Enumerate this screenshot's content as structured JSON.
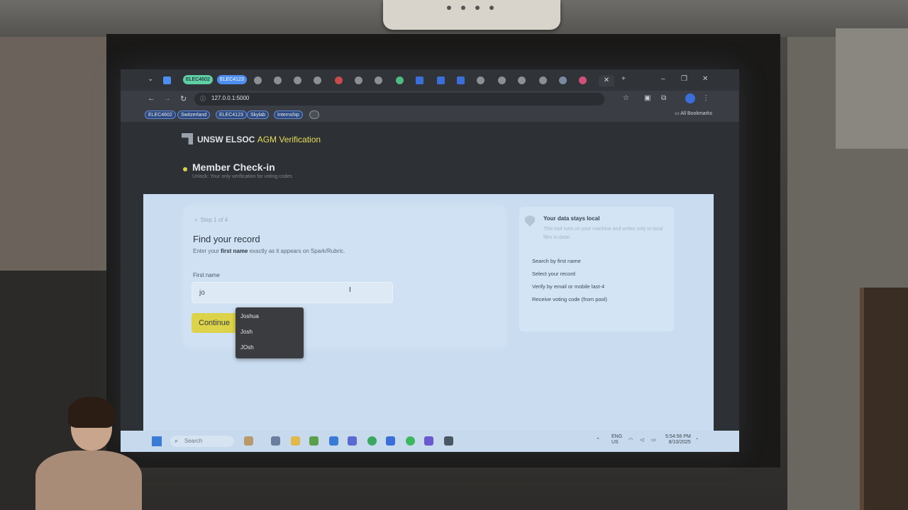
{
  "browser": {
    "tab_pills": [
      "ELEC4602",
      "ELEC4123"
    ],
    "url": "127.0.0.1:5000",
    "bookmarks": [
      "ELEC4602",
      "Switzerland",
      "ELEC4123",
      "Skylab",
      "Internship"
    ],
    "all_bookmarks": "All Bookmarks"
  },
  "app": {
    "brand": "UNSW ELSOC",
    "brand_accent": "AGM Verification",
    "page_title": "Member Check-in",
    "page_subtitle": "Unlock: Your only verification for voting codes"
  },
  "form": {
    "step": "Step 1 of 4",
    "heading": "Find your record",
    "hint_prefix": "Enter your ",
    "hint_bold": "first name",
    "hint_suffix": " exactly as it appears on Spark/Rubric.",
    "field_label": "First name",
    "input_value": "jo",
    "continue_label": "Continue",
    "suggestions": [
      "Joshua",
      "Josh",
      "JOsh"
    ]
  },
  "aside": {
    "title": "Your data stays local",
    "description": "This tool runs on your machine and writes only to local files in data/.",
    "steps": [
      "Search by first name",
      "Select your record",
      "Verify by email or mobile last-4",
      "Receive voting code (from pool)"
    ]
  },
  "taskbar": {
    "search_placeholder": "Search",
    "lang": "ENG",
    "lang_region": "US",
    "time": "5:54:56 PM",
    "date": "8/10/2025"
  },
  "colors": {
    "accent_yellow": "#dcd34a",
    "panel_bg": "#c9dcf0",
    "page_bg": "#2d3034"
  }
}
